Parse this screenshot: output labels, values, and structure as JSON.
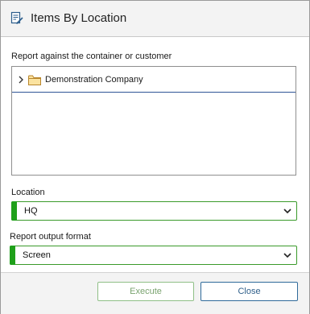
{
  "window": {
    "title": "Items By Location",
    "icon": "report-icon"
  },
  "tree_section": {
    "label": "Report against the container or customer",
    "items": [
      {
        "label": "Demonstration Company",
        "expander_icon": "chevron-right-icon",
        "icon": "folder-icon"
      }
    ]
  },
  "location": {
    "label": "Location",
    "value": "HQ"
  },
  "output_format": {
    "label": "Report output format",
    "value": "Screen"
  },
  "buttons": {
    "execute": "Execute",
    "close": "Close"
  },
  "colors": {
    "accent_green": "#1fa01a",
    "tree_selection_line": "#2f5597",
    "close_border": "#2f6a9a"
  }
}
